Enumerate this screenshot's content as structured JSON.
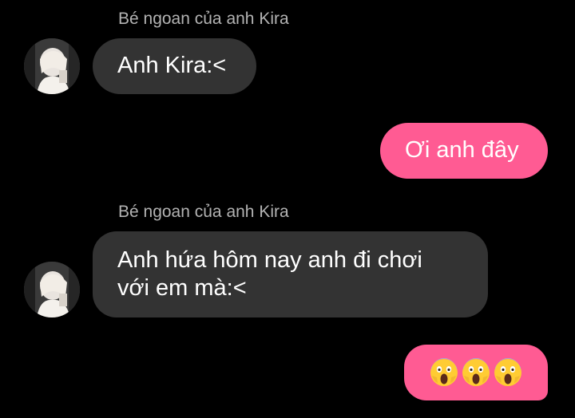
{
  "colors": {
    "background": "#000000",
    "incoming_bubble": "#333333",
    "outgoing_bubble": "#ff5b93",
    "sender_name": "#b3b3b3"
  },
  "messages": [
    {
      "direction": "incoming",
      "sender": "Bé ngoan của anh Kira",
      "text": "Anh Kira:<"
    },
    {
      "direction": "outgoing",
      "text": "Ơi anh đây"
    },
    {
      "direction": "incoming",
      "sender": "Bé ngoan của anh Kira",
      "text": "Anh hứa hôm nay anh đi chơi\nvới em mà:<"
    },
    {
      "direction": "outgoing",
      "emojis": [
        "face-screaming-in-fear",
        "face-screaming-in-fear",
        "face-screaming-in-fear"
      ]
    }
  ]
}
